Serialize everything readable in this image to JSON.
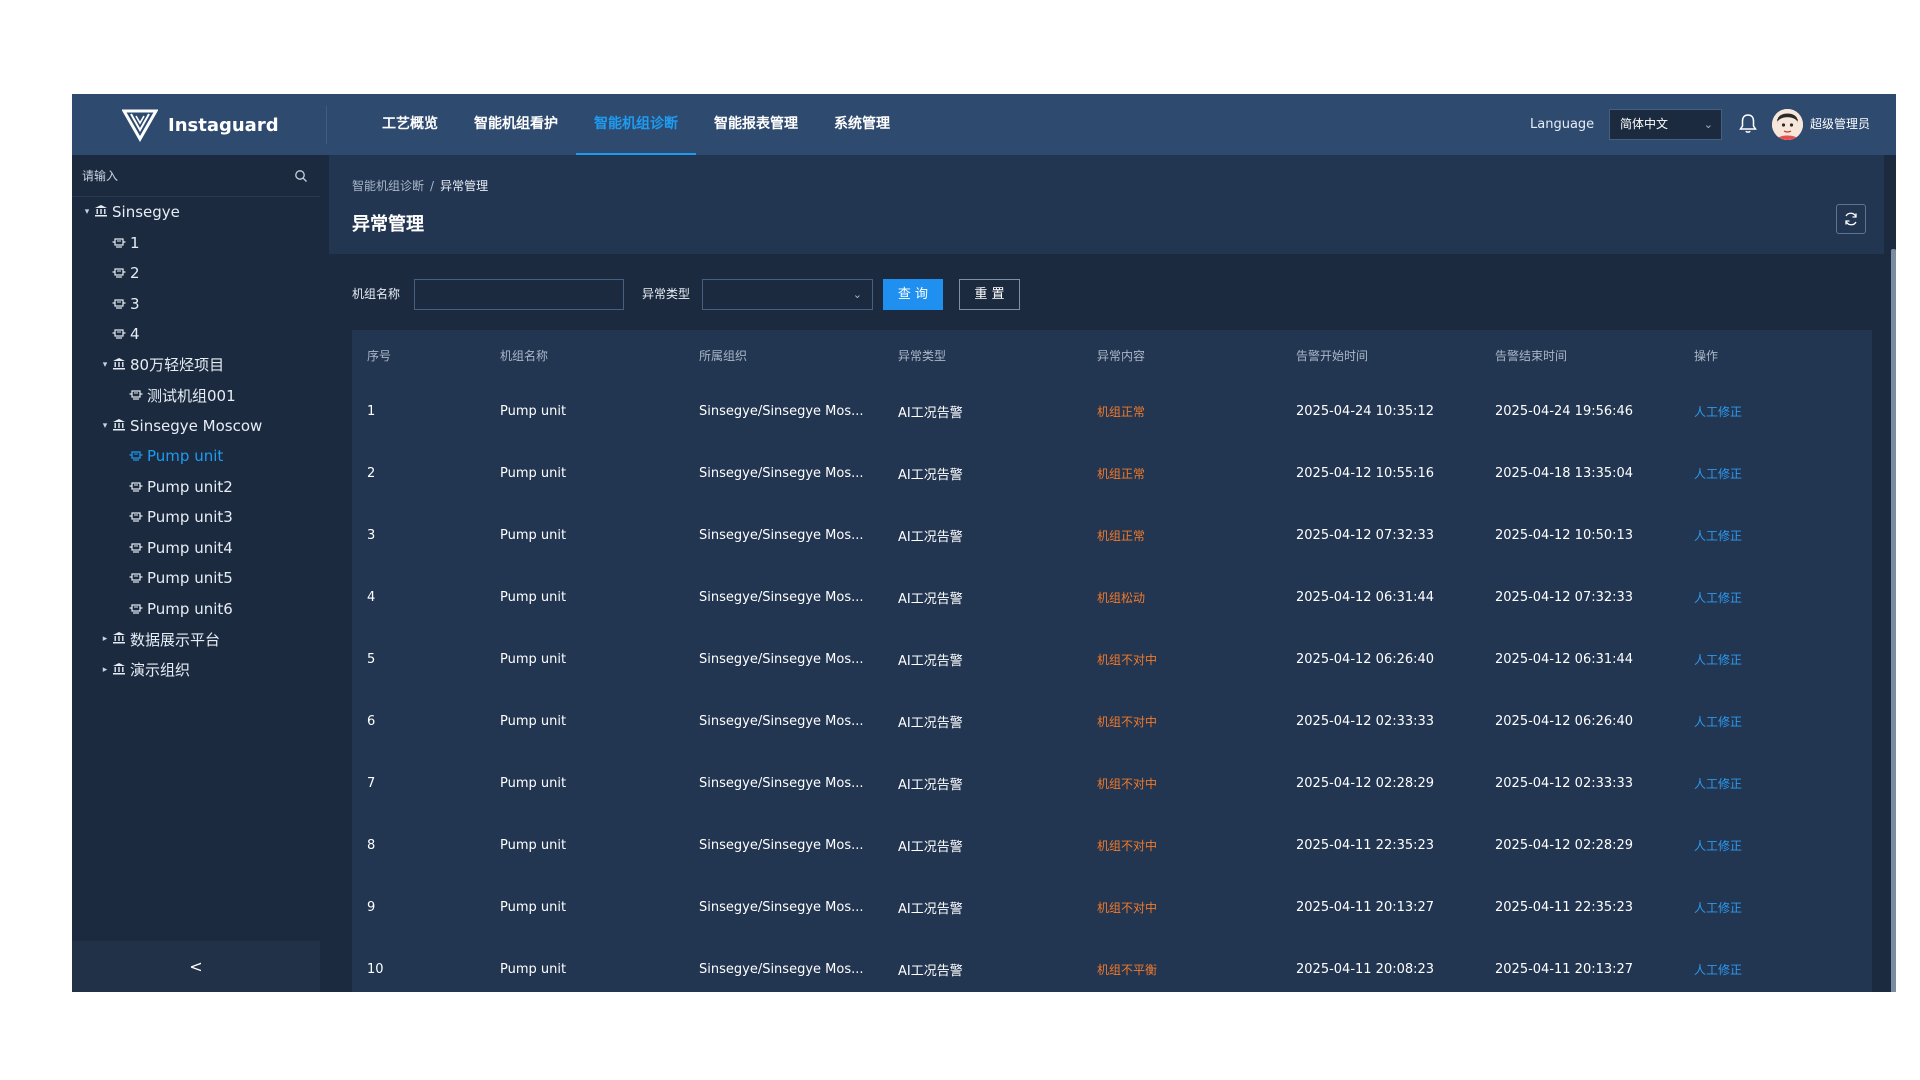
{
  "header": {
    "app_name": "Instaguard",
    "nav": [
      {
        "label": "工艺概览",
        "active": false
      },
      {
        "label": "智能机组看护",
        "active": false
      },
      {
        "label": "智能机组诊断",
        "active": true
      },
      {
        "label": "智能报表管理",
        "active": false
      },
      {
        "label": "系统管理",
        "active": false
      }
    ],
    "language_label": "Language",
    "language_value": "简体中文",
    "username": "超级管理员"
  },
  "sidebar": {
    "search_placeholder": "请输入",
    "tree": [
      {
        "label": "Sinsegye",
        "level": 0,
        "type": "org",
        "expanded": true
      },
      {
        "label": "1",
        "level": 1,
        "type": "unit"
      },
      {
        "label": "2",
        "level": 1,
        "type": "unit"
      },
      {
        "label": "3",
        "level": 1,
        "type": "unit"
      },
      {
        "label": "4",
        "level": 1,
        "type": "unit"
      },
      {
        "label": "80万轻烃项目",
        "level": 1,
        "type": "org",
        "expanded": true
      },
      {
        "label": "测试机组001",
        "level": 2,
        "type": "unit"
      },
      {
        "label": "Sinsegye Moscow",
        "level": 1,
        "type": "org",
        "expanded": true
      },
      {
        "label": "Pump unit",
        "level": 2,
        "type": "unit",
        "active": true
      },
      {
        "label": "Pump unit2",
        "level": 2,
        "type": "unit"
      },
      {
        "label": "Pump unit3",
        "level": 2,
        "type": "unit"
      },
      {
        "label": "Pump unit4",
        "level": 2,
        "type": "unit"
      },
      {
        "label": "Pump unit5",
        "level": 2,
        "type": "unit"
      },
      {
        "label": "Pump unit6",
        "level": 2,
        "type": "unit"
      },
      {
        "label": "数据展示平台",
        "level": 1,
        "type": "org",
        "expanded": false
      },
      {
        "label": "演示组织",
        "level": 1,
        "type": "org",
        "expanded": false
      }
    ],
    "collapse_label": "<"
  },
  "page": {
    "breadcrumb_parent": "智能机组诊断",
    "breadcrumb_sep": "/",
    "breadcrumb_current": "异常管理",
    "title": "异常管理"
  },
  "filters": {
    "unit_name_label": "机组名称",
    "unit_name_value": "",
    "abnormal_type_label": "异常类型",
    "abnormal_type_value": "",
    "query_label": "查 询",
    "reset_label": "重 置"
  },
  "table": {
    "columns": [
      "序号",
      "机组名称",
      "所属组织",
      "异常类型",
      "异常内容",
      "告警开始时间",
      "告警结束时间",
      "操作"
    ],
    "rows": [
      [
        "1",
        "Pump unit",
        "Sinsegye/Sinsegye Mos...",
        "AI工况告警",
        "机组正常",
        "2025-04-24 10:35:12",
        "2025-04-24 19:56:46",
        "人工修正"
      ],
      [
        "2",
        "Pump unit",
        "Sinsegye/Sinsegye Mos...",
        "AI工况告警",
        "机组正常",
        "2025-04-12 10:55:16",
        "2025-04-18 13:35:04",
        "人工修正"
      ],
      [
        "3",
        "Pump unit",
        "Sinsegye/Sinsegye Mos...",
        "AI工况告警",
        "机组正常",
        "2025-04-12 07:32:33",
        "2025-04-12 10:50:13",
        "人工修正"
      ],
      [
        "4",
        "Pump unit",
        "Sinsegye/Sinsegye Mos...",
        "AI工况告警",
        "机组松动",
        "2025-04-12 06:31:44",
        "2025-04-12 07:32:33",
        "人工修正"
      ],
      [
        "5",
        "Pump unit",
        "Sinsegye/Sinsegye Mos...",
        "AI工况告警",
        "机组不对中",
        "2025-04-12 06:26:40",
        "2025-04-12 06:31:44",
        "人工修正"
      ],
      [
        "6",
        "Pump unit",
        "Sinsegye/Sinsegye Mos...",
        "AI工况告警",
        "机组不对中",
        "2025-04-12 02:33:33",
        "2025-04-12 06:26:40",
        "人工修正"
      ],
      [
        "7",
        "Pump unit",
        "Sinsegye/Sinsegye Mos...",
        "AI工况告警",
        "机组不对中",
        "2025-04-12 02:28:29",
        "2025-04-12 02:33:33",
        "人工修正"
      ],
      [
        "8",
        "Pump unit",
        "Sinsegye/Sinsegye Mos...",
        "AI工况告警",
        "机组不对中",
        "2025-04-11 22:35:23",
        "2025-04-12 02:28:29",
        "人工修正"
      ],
      [
        "9",
        "Pump unit",
        "Sinsegye/Sinsegye Mos...",
        "AI工况告警",
        "机组不对中",
        "2025-04-11 20:13:27",
        "2025-04-11 22:35:23",
        "人工修正"
      ],
      [
        "10",
        "Pump unit",
        "Sinsegye/Sinsegye Mos...",
        "AI工况告警",
        "机组不平衡",
        "2025-04-11 20:08:23",
        "2025-04-11 20:13:27",
        "人工修正"
      ]
    ]
  },
  "colors": {
    "header_bg": "#2e4a6f",
    "page_bg": "#1b2a3f",
    "accent": "#1f9bf0",
    "abnormal_text": "#f07a2a",
    "link": "#2d9bf0"
  },
  "icons": {
    "logo": "v-shield-logo",
    "bell": "bell-icon",
    "search": "search-icon",
    "refresh": "refresh-icon",
    "org": "bank-icon",
    "unit": "pump-unit-icon"
  }
}
